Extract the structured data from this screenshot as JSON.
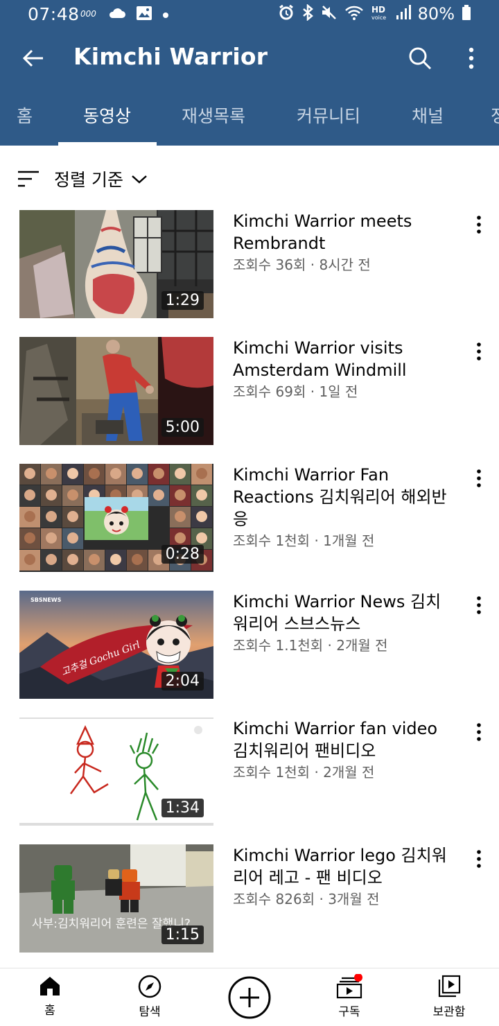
{
  "status_bar": {
    "time": "07:48",
    "battery": "80%",
    "left_icons": [
      "gear-text-icon",
      "cloud-icon",
      "image-icon",
      "dot-icon"
    ],
    "right_icons": [
      "alarm-icon",
      "bluetooth-icon",
      "mute-icon",
      "wifi-icon",
      "hd-voice-icon",
      "signal-icon",
      "battery-icon"
    ]
  },
  "appbar": {
    "title": "Kimchi Warrior",
    "color": "#2f5a88"
  },
  "tabs": [
    {
      "label": "홈"
    },
    {
      "label": "동영상"
    },
    {
      "label": "재생목록"
    },
    {
      "label": "커뮤니티"
    },
    {
      "label": "채널"
    },
    {
      "label": "정"
    }
  ],
  "sort": {
    "label": "정렬 기준"
  },
  "videos": [
    {
      "title": "Kimchi Warrior meets Rembrandt",
      "meta": "조회수 36회 · 8시간 전",
      "duration": "1:29"
    },
    {
      "title": "Kimchi Warrior visits Amsterdam Windmill",
      "meta": "조회수 69회 · 1일 전",
      "duration": "5:00"
    },
    {
      "title": "Kimchi Warrior Fan Reactions 김치워리어 해외반응",
      "meta": "조회수 1천회 · 1개월 전",
      "duration": "0:28"
    },
    {
      "title": "Kimchi Warrior News 김치워리어 스브스뉴스",
      "meta": "조회수 1.1천회 · 2개월 전",
      "duration": "2:04",
      "thumb_text": "고추걸 Gochu Girl",
      "thumb_logo": "SBSNEWS"
    },
    {
      "title": "Kimchi Warrior fan video 김치워리어 팬비디오",
      "meta": "조회수 1천회 · 2개월 전",
      "duration": "1:34"
    },
    {
      "title": "Kimchi Warrior lego 김치워리어 레고 - 팬 비디오",
      "meta": "조회수 826회 · 3개월 전",
      "duration": "1:15",
      "subtitle": "사부:김치워리어 훈련은 잘했니?"
    }
  ],
  "bottom_nav": [
    {
      "label": "홈",
      "icon": "home-icon"
    },
    {
      "label": "탐색",
      "icon": "compass-icon"
    },
    {
      "label": "",
      "icon": "create-icon"
    },
    {
      "label": "구독",
      "icon": "subscriptions-icon"
    },
    {
      "label": "보관함",
      "icon": "library-icon"
    }
  ]
}
